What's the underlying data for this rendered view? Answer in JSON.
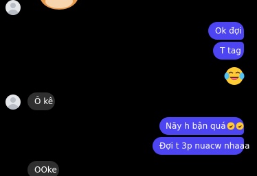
{
  "messages": {
    "ok_doi": "Ok đợi",
    "t_tag": "T tag",
    "o_ke": "Ô kê",
    "nay_h": "Nãy h bận quá",
    "doi_t": "Đợi t 3p nuacw nhaaa",
    "ooke": "OOke"
  },
  "colors": {
    "outgoing_bubble": "#4d45f2",
    "incoming_bubble": "#2f2f2f",
    "background": "#000000"
  },
  "icons": {
    "sticker": "shiba-dog-sticker",
    "reaction": "joy-emoji",
    "inline_emoji": "rofl-emoji"
  }
}
